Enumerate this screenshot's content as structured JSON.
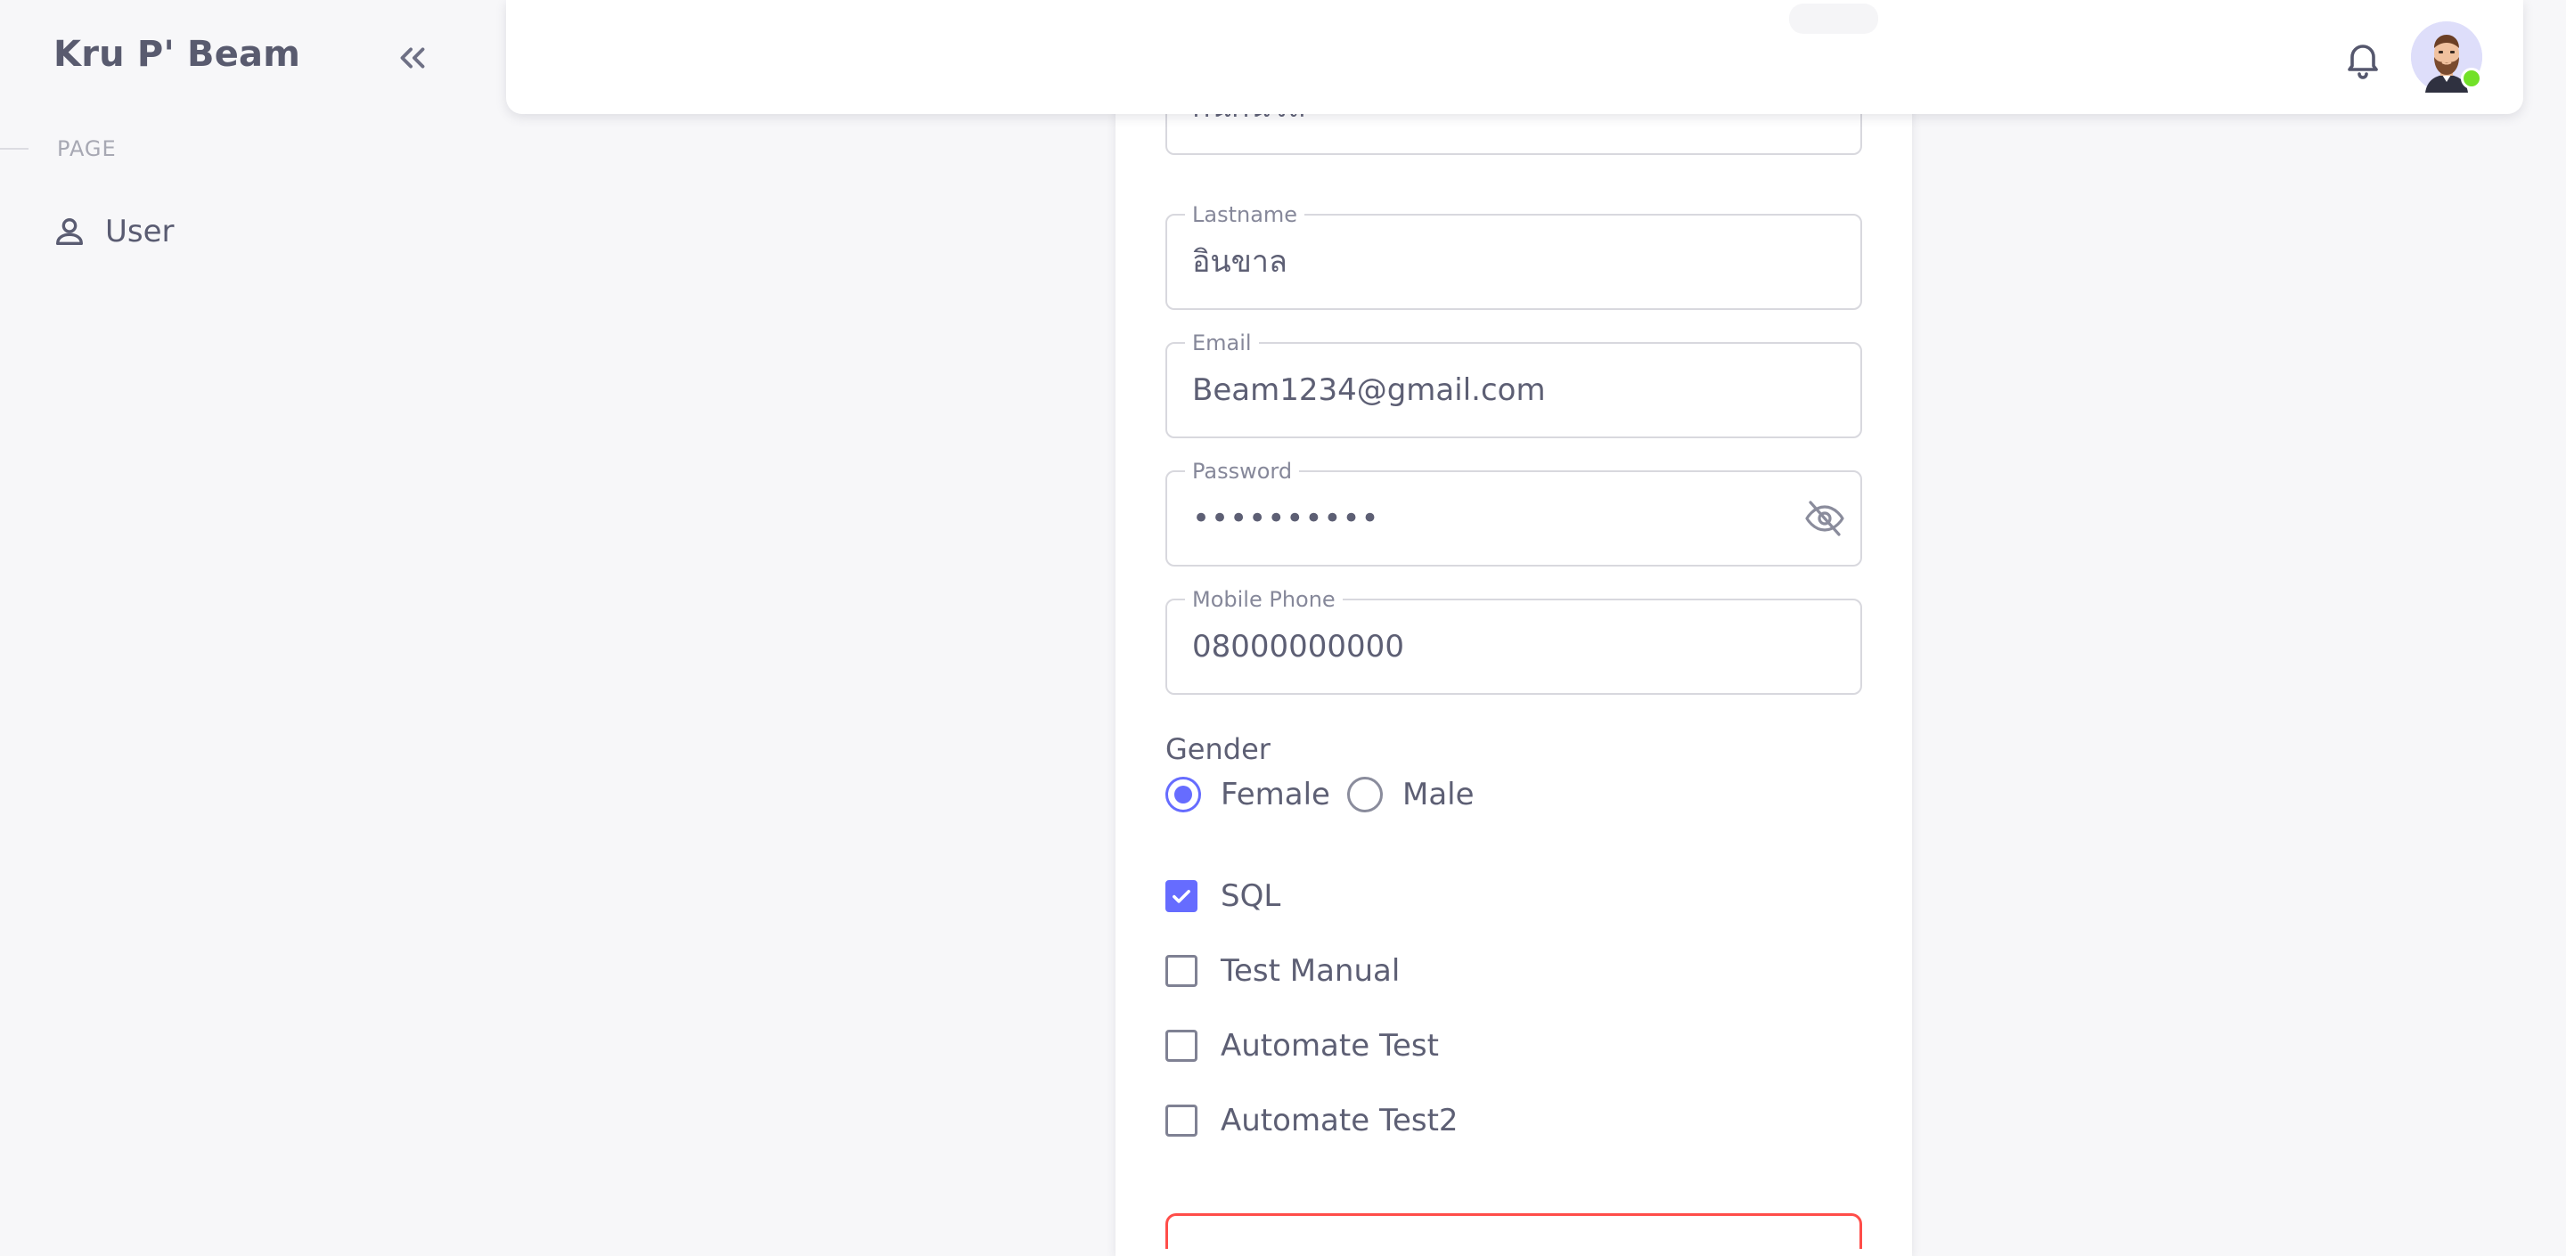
{
  "sidebar": {
    "brand": "Kru P' Beam",
    "section_label": "PAGE",
    "items": [
      {
        "label": "User",
        "icon": "user-outline-icon"
      }
    ]
  },
  "form": {
    "firstname": {
      "value": "กนกนวล"
    },
    "lastname": {
      "legend": "Lastname",
      "value": "อินขาล"
    },
    "email": {
      "legend": "Email",
      "value": "Beam1234@gmail.com"
    },
    "password": {
      "legend": "Password",
      "value": "••••••••••"
    },
    "phone": {
      "legend": "Mobile Phone",
      "value": "08000000000"
    },
    "gender": {
      "title": "Gender",
      "options": [
        {
          "label": "Female",
          "selected": true
        },
        {
          "label": "Male",
          "selected": false
        }
      ]
    },
    "skills": [
      {
        "label": "SQL",
        "checked": true
      },
      {
        "label": "Test Manual",
        "checked": false
      },
      {
        "label": "Automate Test",
        "checked": false
      },
      {
        "label": "Automate Test2",
        "checked": false
      }
    ]
  },
  "colors": {
    "primary": "#666cff",
    "text": "#4c4e64",
    "background": "#f7f7f9",
    "danger": "#ff4d49",
    "online": "#72e128"
  }
}
